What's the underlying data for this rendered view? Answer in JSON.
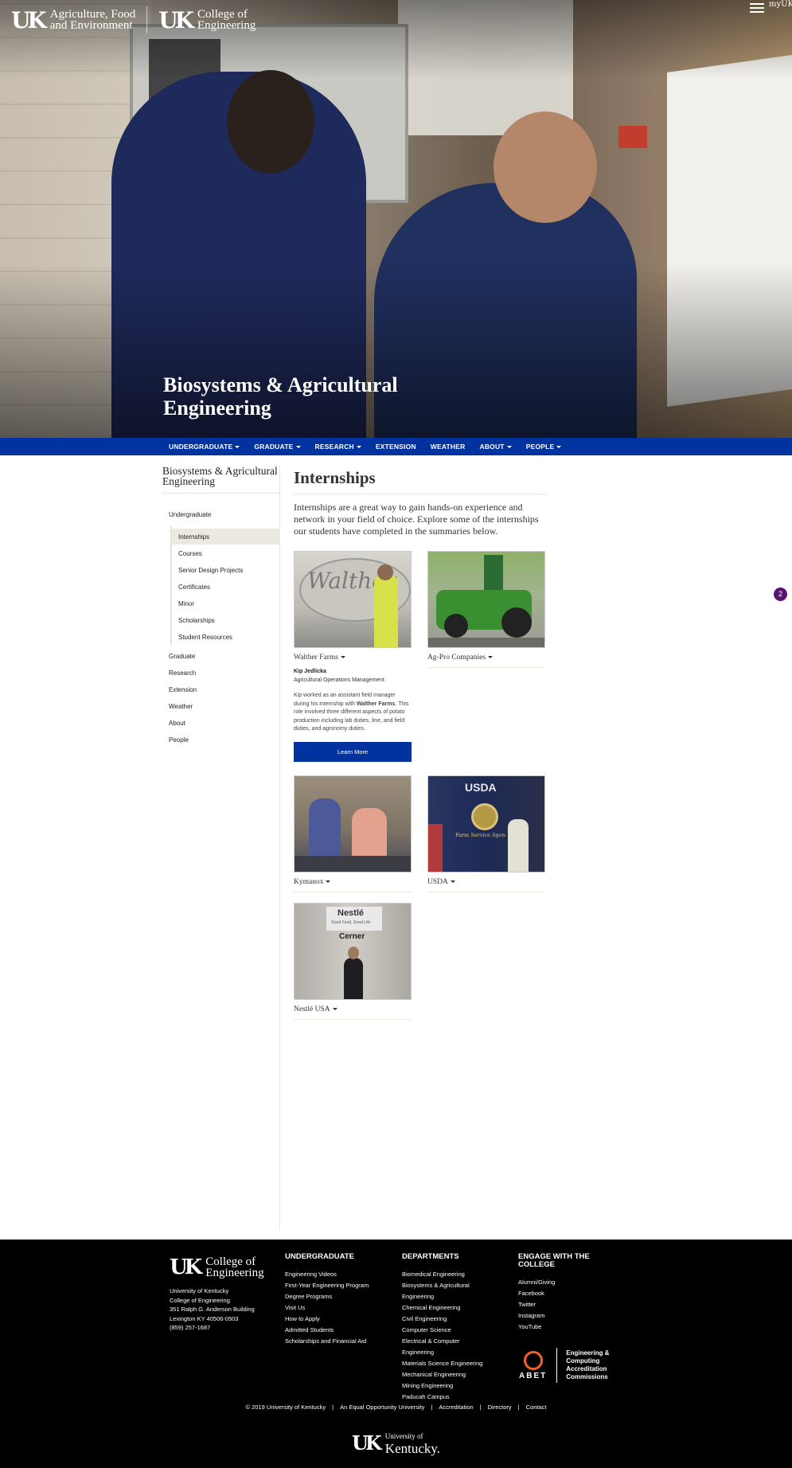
{
  "header": {
    "logo_mark": "UK",
    "logo1_line1": "Agriculture, Food",
    "logo1_line2": "and Environment",
    "logo2_line1": "College of",
    "logo2_line2": "Engineering",
    "myuk": "myUK",
    "hero_title_line1": "Biosystems & Agricultural",
    "hero_title_line2": "Engineering"
  },
  "nav": {
    "items": [
      {
        "label": "UNDERGRADUATE",
        "dropdown": true
      },
      {
        "label": "GRADUATE",
        "dropdown": true
      },
      {
        "label": "RESEARCH",
        "dropdown": true
      },
      {
        "label": "EXTENSION",
        "dropdown": false
      },
      {
        "label": "WEATHER",
        "dropdown": false
      },
      {
        "label": "ABOUT",
        "dropdown": true
      },
      {
        "label": "PEOPLE",
        "dropdown": true
      }
    ]
  },
  "sidebar": {
    "title_line1": "Biosystems & Agricultural",
    "title_line2": "Engineering",
    "undergraduate": "Undergraduate",
    "sub_items": [
      "Internships",
      "Courses",
      "Senior Design Projects",
      "Certificates",
      "Minor",
      "Scholarships",
      "Student Resources"
    ],
    "items": [
      "Graduate",
      "Research",
      "Extension",
      "Weather",
      "About",
      "People"
    ]
  },
  "main": {
    "title": "Internships",
    "intro": "Internships are a great way to gain hands-on experience and network in your field of choice. Explore some of the internships our students have completed in the summaries below.",
    "cards": [
      {
        "label": "Walther Farms"
      },
      {
        "label": "Ag-Pro Companies"
      },
      {
        "label": "Kymanox"
      },
      {
        "label": "USDA"
      },
      {
        "label": "Nestlé USA"
      }
    ],
    "detail": {
      "name": "Kip Jedlicka",
      "role": "Agricultural Operations Management",
      "desc_a": "Kip worked as an assistant field manager during his internship with ",
      "desc_bold": "Walther Farms",
      "desc_b": ". This role involved three different aspects of potato production including lab duties, line, and field duties, and agronomy duties.",
      "button": "Learn More"
    },
    "image_text": {
      "walther": "Walther",
      "usda": "USDA",
      "farm_service": "Farm Service Agen",
      "nestle": "Nestlé",
      "nestle_tag": "Good Food, Good Life",
      "cerner": "Cerner"
    },
    "badge": "2"
  },
  "footer": {
    "logo_line1": "College of",
    "logo_line2": "Engineering",
    "address": [
      "University of Kentucky",
      "College of Engineering",
      "351 Ralph G. Anderson Building",
      "Lexington KY 40506-0503",
      "(859) 257-1687"
    ],
    "undergrad_title": "UNDERGRADUATE",
    "undergrad_links": [
      "Engineering Videos",
      "First-Year Engineering Program",
      "Degree Programs",
      "Visit Us",
      "How to Apply",
      "Admitted Students",
      "Scholarships and Financial Aid"
    ],
    "dept_title": "DEPARTMENTS",
    "dept_links": [
      "Biomedical Engineering",
      "Biosystems & Agricultural Engineering",
      "Chemical Engineering",
      "Civil Engineering",
      "Computer Science",
      "Electrical & Computer Engineering",
      "Materials Science Engineering",
      "Mechanical Engineering",
      "Mining Engineering",
      "Paducah Campus"
    ],
    "engage_title": "ENGAGE WITH THE COLLEGE",
    "engage_links": [
      "Alumni/Giving",
      "Facebook",
      "Twitter",
      "Instagram",
      "YouTube"
    ],
    "abet_word": "ABET",
    "abet_text": [
      "Engineering &",
      "Computing",
      "Accreditation",
      "Commissions"
    ],
    "bottom_links": [
      "© 2019 University of Kentucky",
      "An Equal Opportunity University",
      "Accreditation",
      "Directory",
      "Contact"
    ],
    "uk_small": "University of",
    "uk_big": "Kentucky."
  },
  "colors": {
    "nav_blue": "#0033a0",
    "badge_purple": "#5b1372",
    "abet_orange": "#f2612b"
  }
}
